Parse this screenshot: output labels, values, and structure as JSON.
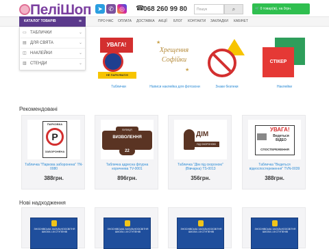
{
  "header": {
    "logo": "ПеліШоп",
    "phone": "068 260 99 80",
    "search_placeholder": "Пошук",
    "cart_label": "0 товар(ів), на 0грн."
  },
  "nav": {
    "items": [
      "ПРО НАС",
      "ОПЛАТА",
      "ДОСТАВКА",
      "АКЦІЇ",
      "БЛОГ",
      "КОНТАКТИ",
      "ЗАКЛАДКИ",
      "КАБІНЕТ"
    ]
  },
  "catalog": {
    "title": "КАТАЛОГ ТОВАРІВ",
    "items": [
      "ТАБЛИЧКИ",
      "ДЛЯ СВЯТА",
      "НАКЛЕЙКИ",
      "СТЕНДИ"
    ]
  },
  "categories": [
    {
      "label": "Таблички",
      "img_text_1": "УВАГА!",
      "img_text_2": "НЕ ПАРКУВАТИ!"
    },
    {
      "label": "Написи наклейка для фотозони",
      "img_text_1": "Хрещення",
      "img_text_2": "Софійки"
    },
    {
      "label": "Знаки безпеки",
      "img_text_1": "",
      "img_text_2": ""
    },
    {
      "label": "Наклейки",
      "img_text_1": "СТІКЕР",
      "img_text_2": ""
    }
  ],
  "recommended": {
    "title": "Рекомендовані",
    "products": [
      {
        "name": "Табличка \"Паркова заборонена\" TN-0080",
        "price": "388грн.",
        "img_top": "ПАРКОВКА",
        "img_bottom": "ЗАБОРОНЕНА"
      },
      {
        "name": "Табличка адресна фігурна коричнева TV-0001",
        "price": "896грн.",
        "img_top": "ВУЛИЦЯ",
        "img_mid": "ВИЗВОЛЕННЯ",
        "img_bottom": "22"
      },
      {
        "name": "Табличка \"Дім під охороною\" (Вівчарка) TS-0013",
        "price": "356грн.",
        "img_top": "ДІМ",
        "img_bottom": "ПІД ОХОРОНОЮ"
      },
      {
        "name": "Табличка \"Ведеться відеоспостереження\" TVN-0039",
        "price": "388грн.",
        "img_top": "УВАГА!",
        "img_mid": "Ведеться ВІДЕО",
        "img_bottom": "СПОСТЕРЕЖЕННЯ"
      }
    ]
  },
  "new_arrivals": {
    "title": "Нові надходження",
    "plate_text": "ЗНОСНІВСЬКА ЗАГАЛЬНООСВІТНЯ ШКОЛА І-ІІІ СТУПЕНІВ"
  },
  "colors": {
    "brand_purple": "#5b3a8c",
    "cart_green": "#2fbf4f",
    "link_blue": "#2a8ad4"
  }
}
